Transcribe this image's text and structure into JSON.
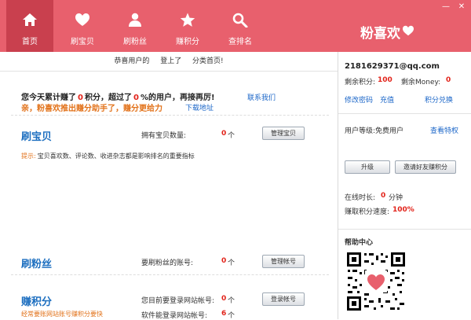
{
  "nav": {
    "tabs": [
      {
        "label": "首页",
        "icon": "home-icon"
      },
      {
        "label": "刷宝贝",
        "icon": "heart-icon"
      },
      {
        "label": "刷粉丝",
        "icon": "user-icon"
      },
      {
        "label": "赚积分",
        "icon": "star-icon"
      },
      {
        "label": "查排名",
        "icon": "search-icon"
      }
    ],
    "logo_text": "粉喜欢"
  },
  "notice": {
    "p1": "恭喜用户的",
    "p2": "登上了",
    "p3": "分类首页!"
  },
  "summary": {
    "p1": "您今天累计赚了",
    "points": "0",
    "p2": "积分，超过了",
    "percent": "0",
    "p3": "%的用户，再接再厉!",
    "contact": "联系我们",
    "promo": "亲，粉喜欢推出赚分助手了，赚分更给力",
    "download": "下载地址"
  },
  "shuabaobei": {
    "title": "刷宝贝",
    "count_label": "拥有宝贝数量:",
    "count_value": "0",
    "count_unit": "个",
    "button": "管理宝贝",
    "tip_label": "提示:",
    "tip_text": "宝贝喜欢数、评论数、收进杂志都是影响排名的重要指标"
  },
  "shuafensi": {
    "title": "刷粉丝",
    "label": "要刷粉丝的账号:",
    "value": "0",
    "unit": "个",
    "button": "管理帐号"
  },
  "zhuanjifen": {
    "title": "赚积分",
    "label1": "您目前要登录网站帐号:",
    "value1": "0",
    "unit1": "个",
    "button": "登录帐号",
    "subtitle": "经常要账网站账号赚积分要快",
    "label2": "软件能登录网站帐号:",
    "value2": "6",
    "unit2": "个"
  },
  "account": {
    "email": "2181629371@qq.com",
    "points_label": "剩余积分:",
    "points_value": "100",
    "money_label": "剩余Money:",
    "money_value": "0",
    "change_password": "修改密码",
    "recharge": "充值",
    "exchange": "积分兑换",
    "level_label": "用户等级:免费用户",
    "view_privileges": "查看特权",
    "upgrade_button": "升级",
    "invite_button": "邀请好友赚积分",
    "online_label": "在线时长:",
    "online_value": "0",
    "online_unit": "分钟",
    "speed_label": "赚取积分速度:",
    "speed_value": "100%"
  },
  "help": {
    "title": "帮助中心"
  },
  "colors": {
    "header": "#e8606d",
    "header_active": "#c9404e",
    "accent_red": "#e2231a",
    "link_blue": "#1b66c8"
  }
}
